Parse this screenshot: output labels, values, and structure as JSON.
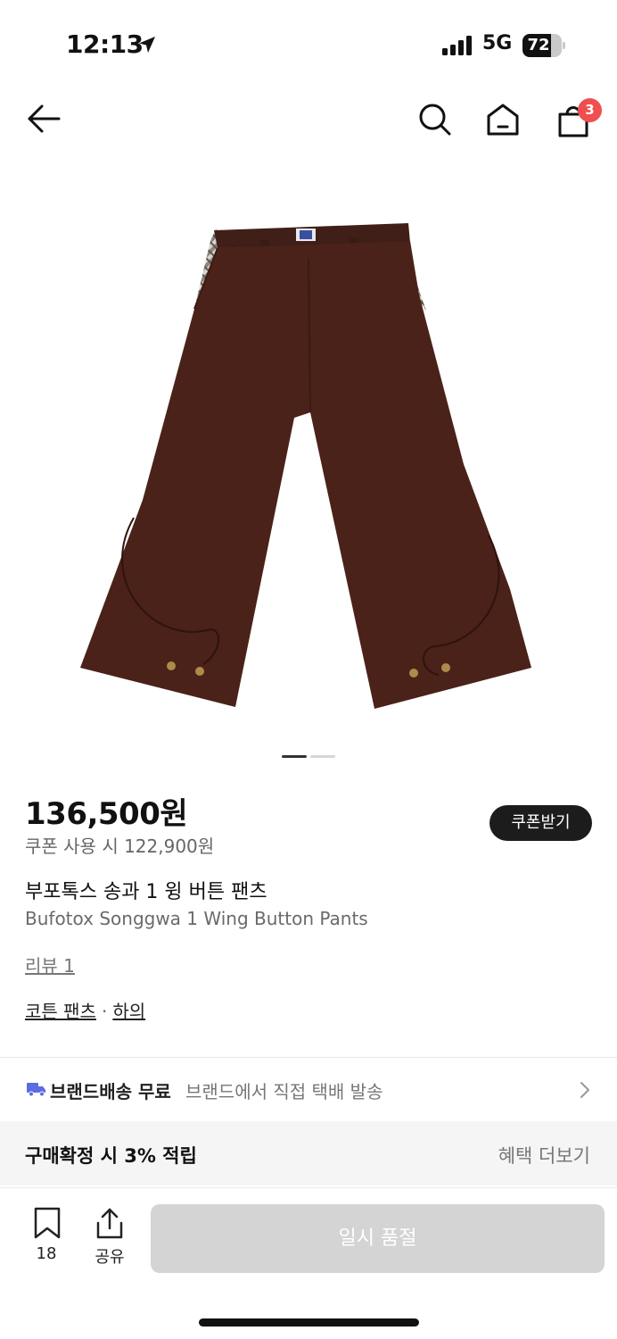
{
  "status_bar": {
    "time": "12:13",
    "network": "5G",
    "battery_percent": "72",
    "battery_level": 0.72
  },
  "nav": {
    "back_icon": "arrow-left-icon",
    "search_icon": "search-icon",
    "home_icon": "home-icon",
    "bag_icon": "shopping-bag-icon",
    "bag_badge": "3",
    "badge_color": "#F04F4F"
  },
  "carousel": {
    "active_index": 1,
    "total": 2
  },
  "product": {
    "price": "136,500원",
    "coupon_price": "쿠폰 사용 시 122,900원",
    "coupon_button": "쿠폰받기",
    "name_ko": "부포톡스 송과 1 윙 버튼 팬츠",
    "name_en": "Bufotox Songgwa 1 Wing Button Pants",
    "reviews": "리뷰 1",
    "category_1": "코튼 팬츠",
    "category_sep": "·",
    "category_2": "하의"
  },
  "shipping": {
    "icon": "truck-icon",
    "icon_color": "#5B6CE0",
    "title": "브랜드배송 무료",
    "desc": "브랜드에서 직접 택배 발송"
  },
  "benefit": {
    "title": "구매확정 시 3% 적립",
    "more": "혜택 더보기"
  },
  "bottom": {
    "save_icon": "bookmark-icon",
    "save_count": "18",
    "share_icon": "share-icon",
    "share_label": "공유",
    "soldout_label": "일시 품절"
  }
}
